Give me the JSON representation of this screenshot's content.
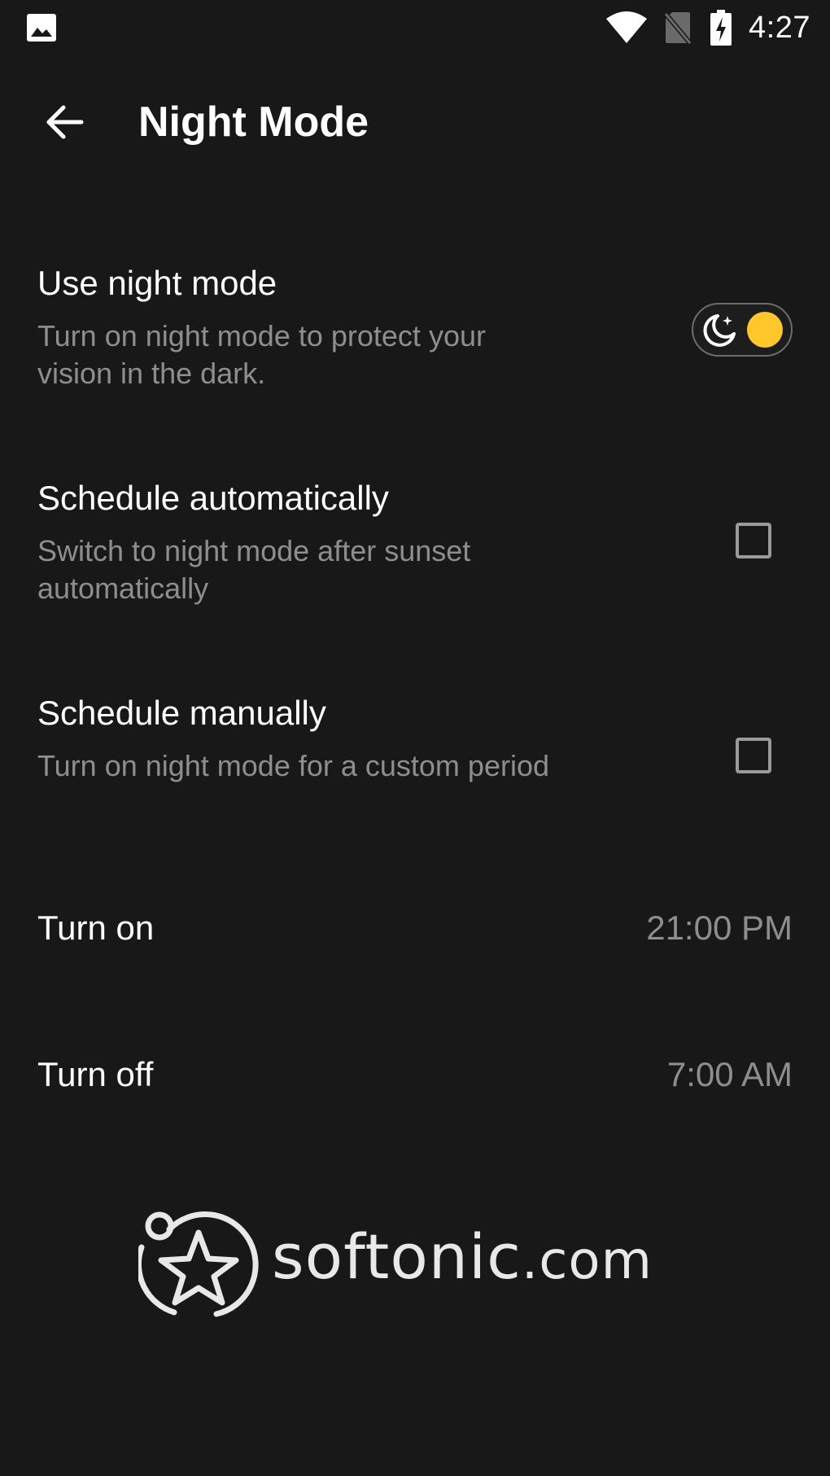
{
  "status_bar": {
    "left_icons": [
      "image-icon"
    ],
    "right_icons": [
      "wifi-icon",
      "no-sim-icon",
      "battery-charging-icon"
    ],
    "time": "4:27"
  },
  "toolbar": {
    "back_icon": "arrow-left-icon",
    "title": "Night Mode"
  },
  "settings": {
    "night_mode": {
      "title": "Use night mode",
      "summary": "Turn on night mode to protect your vision in the dark.",
      "enabled": true,
      "toggle_icon": "moon-icon"
    },
    "schedule_auto": {
      "title": "Schedule automatically",
      "summary": "Switch to night mode after sunset automatically",
      "checked": false
    },
    "schedule_manual": {
      "title": "Schedule manually",
      "summary": "Turn on night mode for a custom period",
      "checked": false
    },
    "turn_on": {
      "title": "Turn on",
      "value": "21:00 PM"
    },
    "turn_off": {
      "title": "Turn off",
      "value": "7:00 AM"
    }
  },
  "watermark": {
    "brand": "softonic",
    "tld": ".com"
  },
  "colors": {
    "background": "#181818",
    "accent": "#ffc72c",
    "summary_text": "#8e8e8e",
    "primary_text": "#ffffff"
  }
}
